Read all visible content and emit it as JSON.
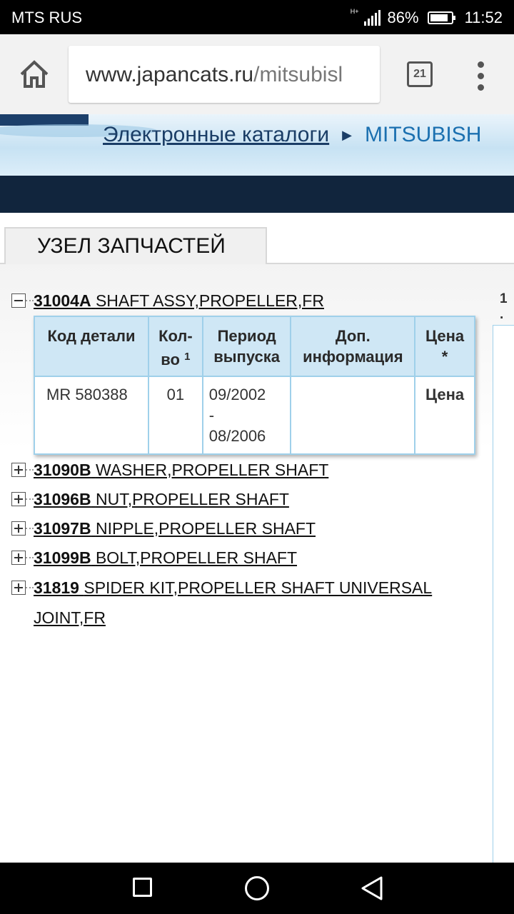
{
  "status_bar": {
    "carrier": "MTS RUS",
    "network": "H+",
    "battery": "86%",
    "battery_level": 0.86,
    "time": "11:52"
  },
  "browser": {
    "url_host": "www.japancats.ru",
    "url_path": "/mitsubisl",
    "tab_count": "21",
    "icons": [
      "home-icon",
      "tabs-icon",
      "overflow-menu-icon"
    ]
  },
  "header": {
    "breadcrumb_link": "Электронные каталоги",
    "breadcrumb_separator": "▶",
    "breadcrumb_current": "MITSUBISH",
    "accent_color": "#11253d"
  },
  "section_tab": {
    "label": "УЗЕЛ ЗАПЧАСТЕЙ"
  },
  "tree": {
    "expanded": {
      "code": "31004A",
      "name": "SHAFT ASSY,PROPELLER,FR"
    },
    "items": [
      {
        "code": "31090B",
        "name": "WASHER,PROPELLER SHAFT"
      },
      {
        "code": "31096B",
        "name": "NUT,PROPELLER SHAFT"
      },
      {
        "code": "31097B",
        "name": "NIPPLE,PROPELLER SHAFT"
      },
      {
        "code": "31099B",
        "name": "BOLT,PROPELLER SHAFT"
      },
      {
        "code": "31819",
        "name": "SPIDER KIT,PROPELLER SHAFT UNIVERSAL",
        "name_cont": "JOINT,FR"
      }
    ]
  },
  "parts_table": {
    "headers": {
      "code": "Код детали",
      "qty_line1": "Кол-",
      "qty_line2": "во",
      "qty_sup": "1",
      "period_line1": "Период",
      "period_line2": "выпуска",
      "info_line1": "Доп.",
      "info_line2": "информация",
      "price_line1": "Цена",
      "price_line2": "*"
    },
    "rows": [
      {
        "code": "MR 580388",
        "qty": "01",
        "period_from": "09/2002",
        "period_dash": "-",
        "period_to": "08/2006",
        "info": "",
        "price": "Цена"
      }
    ],
    "price_color": "#e00000",
    "border_color": "#9fd0ea"
  },
  "right_column": {
    "number": "1 ."
  },
  "nav_bar": {
    "icons": [
      "recent-apps-icon",
      "home-circle-icon",
      "back-icon"
    ]
  }
}
